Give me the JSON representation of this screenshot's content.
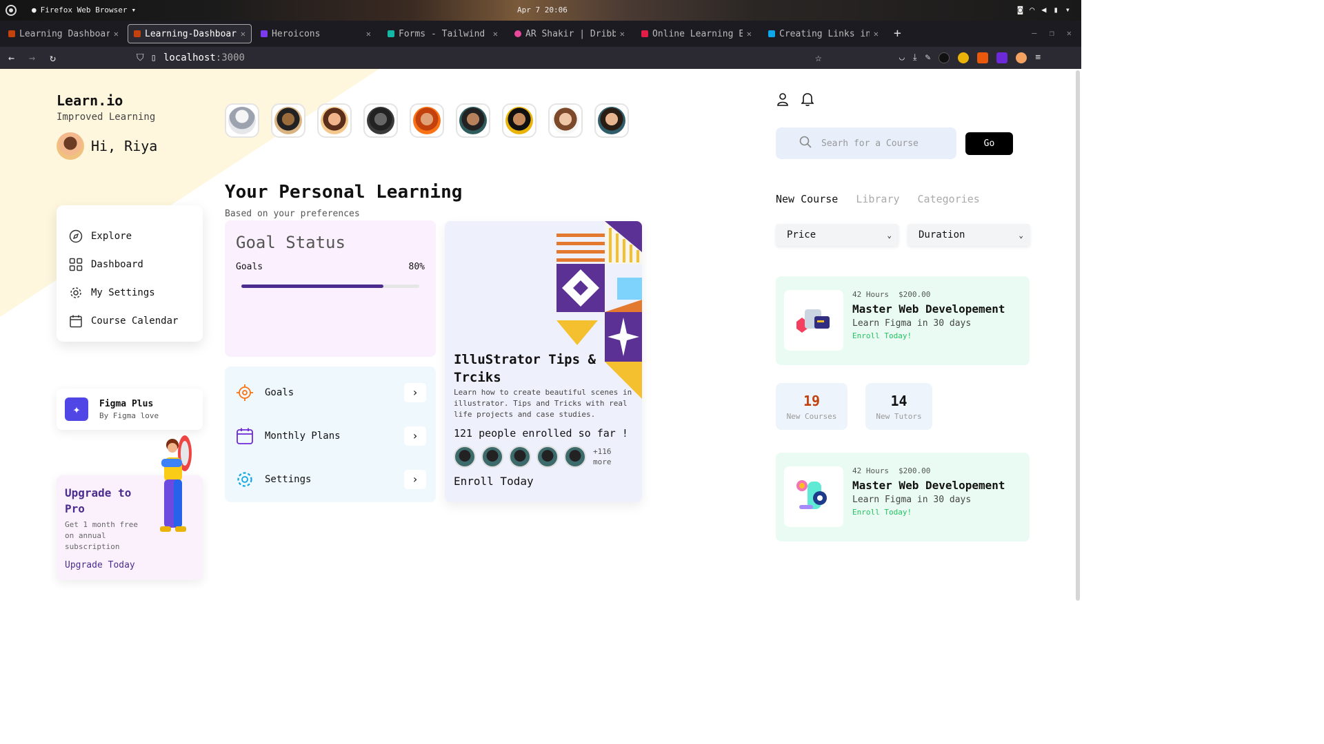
{
  "system": {
    "app_name": "Firefox Web Browser",
    "clock": "Apr 7 20:06"
  },
  "browser": {
    "tabs": [
      {
        "label": "Learning Dashboard",
        "color": "#c2410c"
      },
      {
        "label": "Learning-Dashboard",
        "color": "#c2410c",
        "active": true
      },
      {
        "label": "Heroicons",
        "color": "#7c3aed"
      },
      {
        "label": "Forms - Tailwind CSS",
        "color": "#14b8a6"
      },
      {
        "label": "AR Shakir | Dribbble",
        "color": "#ec4899"
      },
      {
        "label": "Online Learning Exploration",
        "color": "#e11d48"
      },
      {
        "label": "Creating Links in",
        "color": "#0ea5e9"
      }
    ],
    "url_host": "localhost",
    "url_port": ":3000"
  },
  "sidebar": {
    "brand": "Learn.io",
    "tagline": "Improved Learning",
    "greeting": "Hi, Riya",
    "menu": [
      {
        "label": "Explore",
        "icon": "compass-icon"
      },
      {
        "label": "Dashboard",
        "icon": "grid-icon"
      },
      {
        "label": "My Settings",
        "icon": "gear-icon"
      },
      {
        "label": "Course Calendar",
        "icon": "calendar-icon"
      }
    ],
    "promo": {
      "title": "Figma Plus",
      "subtitle": "By Figma love"
    },
    "upgrade": {
      "title": "Upgrade to Pro",
      "description": "Get 1 month free on annual subscription",
      "link": "Upgrade Today"
    }
  },
  "main": {
    "title": "Your Personal Learning",
    "subtitle": "Based on your preferences",
    "goal": {
      "title": "Goal Status",
      "label": "Goals",
      "percent_text": "80%",
      "progress": 0.8
    },
    "quick_links": [
      {
        "label": "Goals",
        "icon": "target-icon"
      },
      {
        "label": "Monthly Plans",
        "icon": "calendar-icon"
      },
      {
        "label": "Settings",
        "icon": "gear-icon"
      }
    ],
    "feature": {
      "title": "IlluStrator Tips & Trciks",
      "description": "Learn how to create beautiful scenes in illustrator. Tips and Tricks with real life projects and case studies.",
      "enrolled": "121 people enrolled so far !",
      "more": "+116 more",
      "cta": "Enroll Today"
    }
  },
  "right": {
    "search_placeholder": "Searh for a Course",
    "go_label": "Go",
    "tabs": [
      "New Course",
      "Library",
      "Categories"
    ],
    "filters": [
      "Price",
      "Duration"
    ],
    "courses": [
      {
        "hours": "42 Hours",
        "price": "$200.00",
        "title": "Master Web Developement",
        "subtitle": "Learn Figma in 30 days",
        "cta": "Enroll Today!"
      },
      {
        "hours": "42 Hours",
        "price": "$200.00",
        "title": "Master Web Developement",
        "subtitle": "Learn Figma in 30 days",
        "cta": "Enroll Today!"
      }
    ],
    "stats": [
      {
        "value": "19",
        "label": "New Courses",
        "color": "#c2410c"
      },
      {
        "value": "14",
        "label": "New Tutors",
        "color": "#111111"
      }
    ]
  },
  "colors": {
    "accent": "#4c2d8f",
    "success": "#22c55e",
    "goal_bg": "#fbf0fd",
    "quick_bg": "#eef8fd",
    "course_bg": "#e9fbf3"
  }
}
